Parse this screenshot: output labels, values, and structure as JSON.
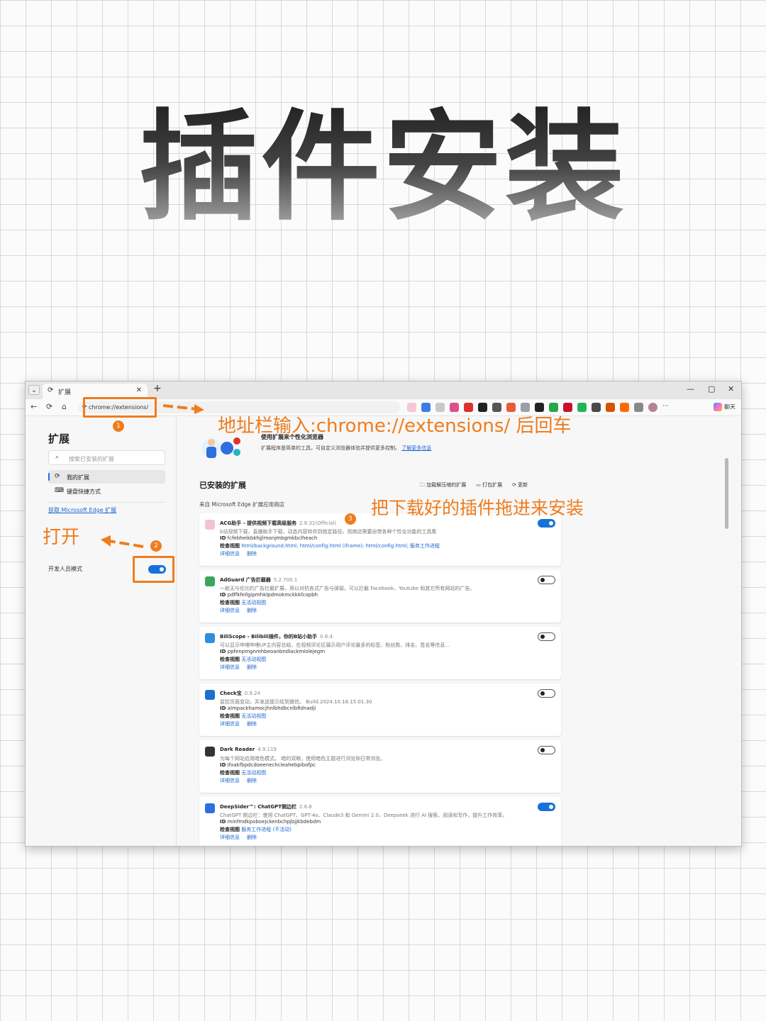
{
  "poster": {
    "title": "插件安装"
  },
  "browser": {
    "tab_title": "扩展",
    "address": "chrome://extensions/",
    "copilot_label": "聊天"
  },
  "sidebar": {
    "title": "扩展",
    "search_placeholder": "搜索已安装的扩展",
    "items": [
      {
        "label": "我的扩展",
        "icon": "extension-icon"
      },
      {
        "label": "键盘快捷方式",
        "icon": "keyboard-icon"
      }
    ],
    "store_link": "获取 Microsoft Edge 扩展",
    "dev_mode_label": "开发人员模式",
    "dev_mode_on": true
  },
  "main": {
    "hero_title": "使用扩展来个性化浏览器",
    "hero_desc": "扩展程序是简单的工具，可自定义浏览器体验并提供更多控制。",
    "hero_link": "了解更多信息",
    "installed_title": "已安装的扩展",
    "actions": [
      "加载解压缩的扩展",
      "打包扩展",
      "更新"
    ],
    "source_label": "来自 Microsoft Edge 扩展应用商店",
    "extensions": [
      {
        "name": "ACG助手 - 提供视频下载高级服务",
        "version": "2.8.31(Official)",
        "desc": "b站视频下载，直播助手下载，动态内容转存到指定路径。而商店需要自带各种个性化功能的工具集",
        "id": "fcfebheikbkhjjlmonjmbgmkbclheach",
        "views": "html/background.html; html/config.html (iframe); html/config.html; 服务工作进程",
        "enabled": true,
        "color": "#f2c4cf"
      },
      {
        "name": "AdGuard 广告拦截器",
        "version": "5.2.700.1",
        "desc": "一款无与伦比的广告拦截扩展，用以对抗各式广告与弹窗。可以拦截 Facebook、Youtube 和其它所有网站的广告。",
        "id": "pdffkfellgipmhklpdmokmckkkfcopbh",
        "views": "无活动视图",
        "enabled": false,
        "color": "#3ba55c"
      },
      {
        "name": "BiliScope - Bilibili插件，你的B站小助手",
        "version": "0.6.4",
        "desc": "可以显示哔哩哔哩UP主内容总结，在视频评论区展示用户评论最多的标签、粉丝数、排名、签名等信息…",
        "id": "ppfenpmgnmhbeoanbndlackmlolejegm",
        "views": "无活动视图",
        "enabled": false,
        "color": "#2f8fdd"
      },
      {
        "name": "Check宝",
        "version": "0.9.24",
        "desc": "监控页面变动，并发送提示给到微信。 Build.2024.10.16.15.01.30",
        "id": "almpackhamocjhnlbhdbcnlbfidnadji",
        "views": "无活动视图",
        "enabled": false,
        "color": "#1a6fd1"
      },
      {
        "name": "Dark Reader",
        "version": "4.9.119",
        "desc": "为每个网站启用暗色模式。 暗的双眼，使用暗色主题进行浏览和日常浏览。",
        "id": "ifoakfbpdcdoeenechcleahebpibofpc",
        "views": "无活动视图",
        "enabled": false,
        "color": "#333333"
      },
      {
        "name": "DeepSider™: ChatGPT侧边栏",
        "version": "2.6.6",
        "desc": "ChatGPT 侧边栏：使用 ChatGPT、GPT-4o、Claude3 和 Gemini 2.0、Deepseek 进行 AI 搜索、阅读和写作，提升工作效率。",
        "id": "minfmdkpoboejckenbchpjbjjkbdebdm",
        "views": "服务工作进程 (不活动)",
        "enabled": true,
        "color": "#2d6fe0"
      }
    ],
    "detail_link": "详细信息",
    "remove_link": "删除",
    "views_label": "检查视图",
    "id_label": "ID"
  },
  "annotations": {
    "step1": "1",
    "step2": "2",
    "step3": "3",
    "address_hint": "地址栏输入:chrome://extensions/ 后回车",
    "open_hint": "打开",
    "drag_hint": "把下载好的插件拖进来安装",
    "accent": "#f07c1c"
  }
}
